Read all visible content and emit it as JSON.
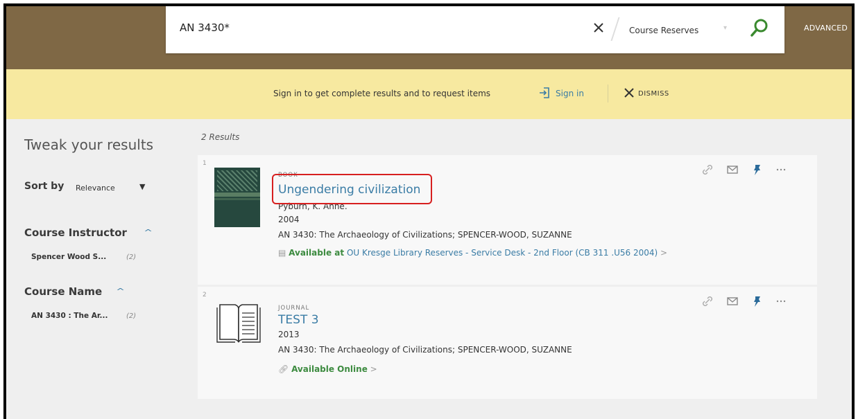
{
  "search": {
    "query": "AN 3430*",
    "scope": "Course Reserves",
    "advanced_label": "ADVANCED"
  },
  "banner": {
    "message": "Sign in to get complete results and to request items",
    "signin_label": "Sign in",
    "dismiss_label": "DISMISS"
  },
  "sidebar": {
    "title": "Tweak your results",
    "sort_label": "Sort by",
    "sort_value": "Relevance",
    "facets": [
      {
        "heading": "Course Instructor",
        "item": "Spencer Wood S...",
        "count": "(2)"
      },
      {
        "heading": "Course Name",
        "item": "AN 3430 : The Ar...",
        "count": "(2)"
      }
    ]
  },
  "results": {
    "count_label": "2 Results",
    "items": [
      {
        "index": "1",
        "type": "BOOK",
        "title": "Ungendering civilization",
        "author": "Pyburn, K. Anne.",
        "year": "2004",
        "course": "AN 3430: The Archaeology of Civilizations; SPENCER-WOOD, SUZANNE",
        "availability_status": "Available at",
        "availability_location": "OU Kresge Library  Reserves - Service Desk - 2nd Floor (CB 311 .U56 2004)",
        "more_glyph": ">"
      },
      {
        "index": "2",
        "type": "JOURNAL",
        "title": "TEST 3",
        "year": "2013",
        "course": "AN 3430: The Archaeology of Civilizations; SPENCER-WOOD, SUZANNE",
        "availability_status": "Available Online",
        "more_glyph": ">"
      }
    ]
  },
  "colors": {
    "topbar": "#7f6845",
    "banner": "#f7e9a0",
    "link": "#3a7ca5",
    "available": "#3d8b40",
    "highlight": "#d71f1f"
  },
  "icons": [
    "close-icon",
    "search-icon",
    "sign-in-icon",
    "dismiss-icon",
    "link-icon",
    "email-icon",
    "pin-icon",
    "more-icon",
    "book-cover",
    "journal-icon"
  ]
}
